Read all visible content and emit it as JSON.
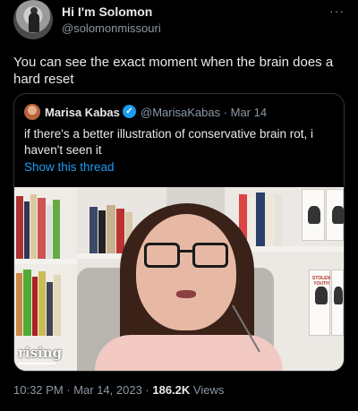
{
  "author": {
    "display_name": "Hi I'm Solomon",
    "handle": "@solomonmissouri"
  },
  "menu_icon": "more-horizontal-icon",
  "tweet": {
    "text": "You can see the exact moment when the brain does a hard reset"
  },
  "quoted": {
    "display_name": "Marisa Kabas",
    "verified_icon": "verified-badge-icon",
    "handle_date": "@MarisaKabas · Mar 14",
    "text": "if there's a better illustration of conservative brain rot, i haven't seen it",
    "show_thread": "Show this thread",
    "media": {
      "watermark": "rising",
      "poster_text": "STOLEN YOUTH"
    }
  },
  "footer": {
    "timestamp": "10:32 PM · Mar 14, 2023 · ",
    "views_count": "186.2K",
    "views_label": " Views"
  },
  "colors": {
    "background": "#000000",
    "link": "#1d9bf0",
    "secondary_text": "#8b98a5"
  }
}
